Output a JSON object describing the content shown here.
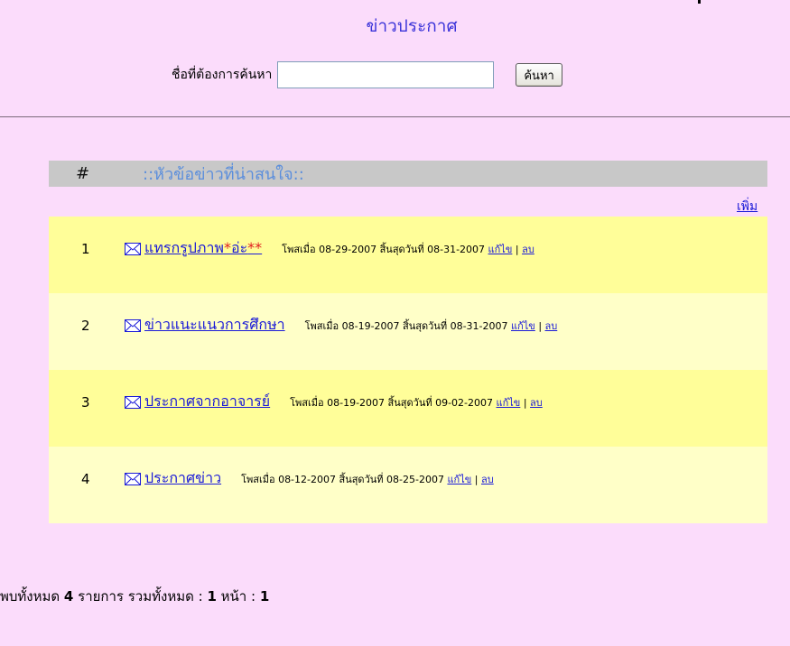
{
  "page": {
    "title": "ข่าวประกาศ"
  },
  "search": {
    "label": "ชื่อที่ต้องการค้นหา",
    "value": "",
    "button_label": "ค้นหา"
  },
  "table": {
    "header_num": "#",
    "header_title": "::หัวข้อข่าวที่น่าสนใจ::",
    "add_label": "เพิ่ม"
  },
  "news": [
    {
      "num": "1",
      "title": "แทรกรูปภาพ",
      "extra_a": "*",
      "extra_b": "อ่ะ",
      "extra_c": "**",
      "meta": "โพสเมื่อ 08-29-2007 สิ้นสุดวันที่ 08-31-2007",
      "edit": "แก้ไข",
      "sep": "|",
      "delete": "ลบ"
    },
    {
      "num": "2",
      "title": "ข่าวแนะแนวการศึกษา",
      "meta": "โพสเมื่อ 08-19-2007 สิ้นสุดวันที่ 08-31-2007",
      "edit": "แก้ไข",
      "sep": "|",
      "delete": "ลบ"
    },
    {
      "num": "3",
      "title": "ประกาศจากอาจารย์",
      "meta": "โพสเมื่อ 08-19-2007 สิ้นสุดวันที่ 09-02-2007",
      "edit": "แก้ไข",
      "sep": "|",
      "delete": "ลบ"
    },
    {
      "num": "4",
      "title": "ประกาศข่าว",
      "meta": "โพสเมื่อ 08-12-2007 สิ้นสุดวันที่ 08-25-2007",
      "edit": "แก้ไข",
      "sep": "|",
      "delete": "ลบ"
    }
  ],
  "footer": {
    "found_prefix": "พบทั้งหมด",
    "found_count": "4",
    "found_suffix": "รายการ รวมทั้งหมด :",
    "pages": "1",
    "page_label": "หน้า :",
    "current": "1"
  },
  "icons": {
    "mail": "envelope-icon"
  },
  "colors": {
    "background": "#fbdcfb",
    "link": "#1a1ad8",
    "title": "#3b33d9",
    "header_bar": "#c8c8c8",
    "row_odd": "#fffe99",
    "row_even": "#ffffc8"
  }
}
